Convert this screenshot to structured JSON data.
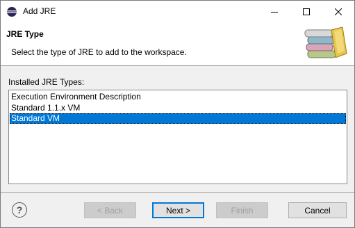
{
  "window": {
    "title": "Add JRE"
  },
  "banner": {
    "title": "JRE Type",
    "description": "Select the type of JRE to add to the workspace."
  },
  "list": {
    "label": "Installed JRE Types:",
    "items": [
      {
        "label": "Execution Environment Description",
        "selected": false
      },
      {
        "label": "Standard 1.1.x VM",
        "selected": false
      },
      {
        "label": "Standard VM",
        "selected": true
      }
    ]
  },
  "buttons": {
    "help_label": "?",
    "back_label": "< Back",
    "next_label": "Next >",
    "finish_label": "Finish",
    "cancel_label": "Cancel"
  },
  "icons": {
    "app": "eclipse-icon",
    "minimize": "minimize-icon",
    "maximize": "maximize-icon",
    "close": "close-icon",
    "banner": "books-icon",
    "help": "help-icon"
  },
  "colors": {
    "selection": "#0078d7",
    "default_button_border": "#0078d7"
  }
}
